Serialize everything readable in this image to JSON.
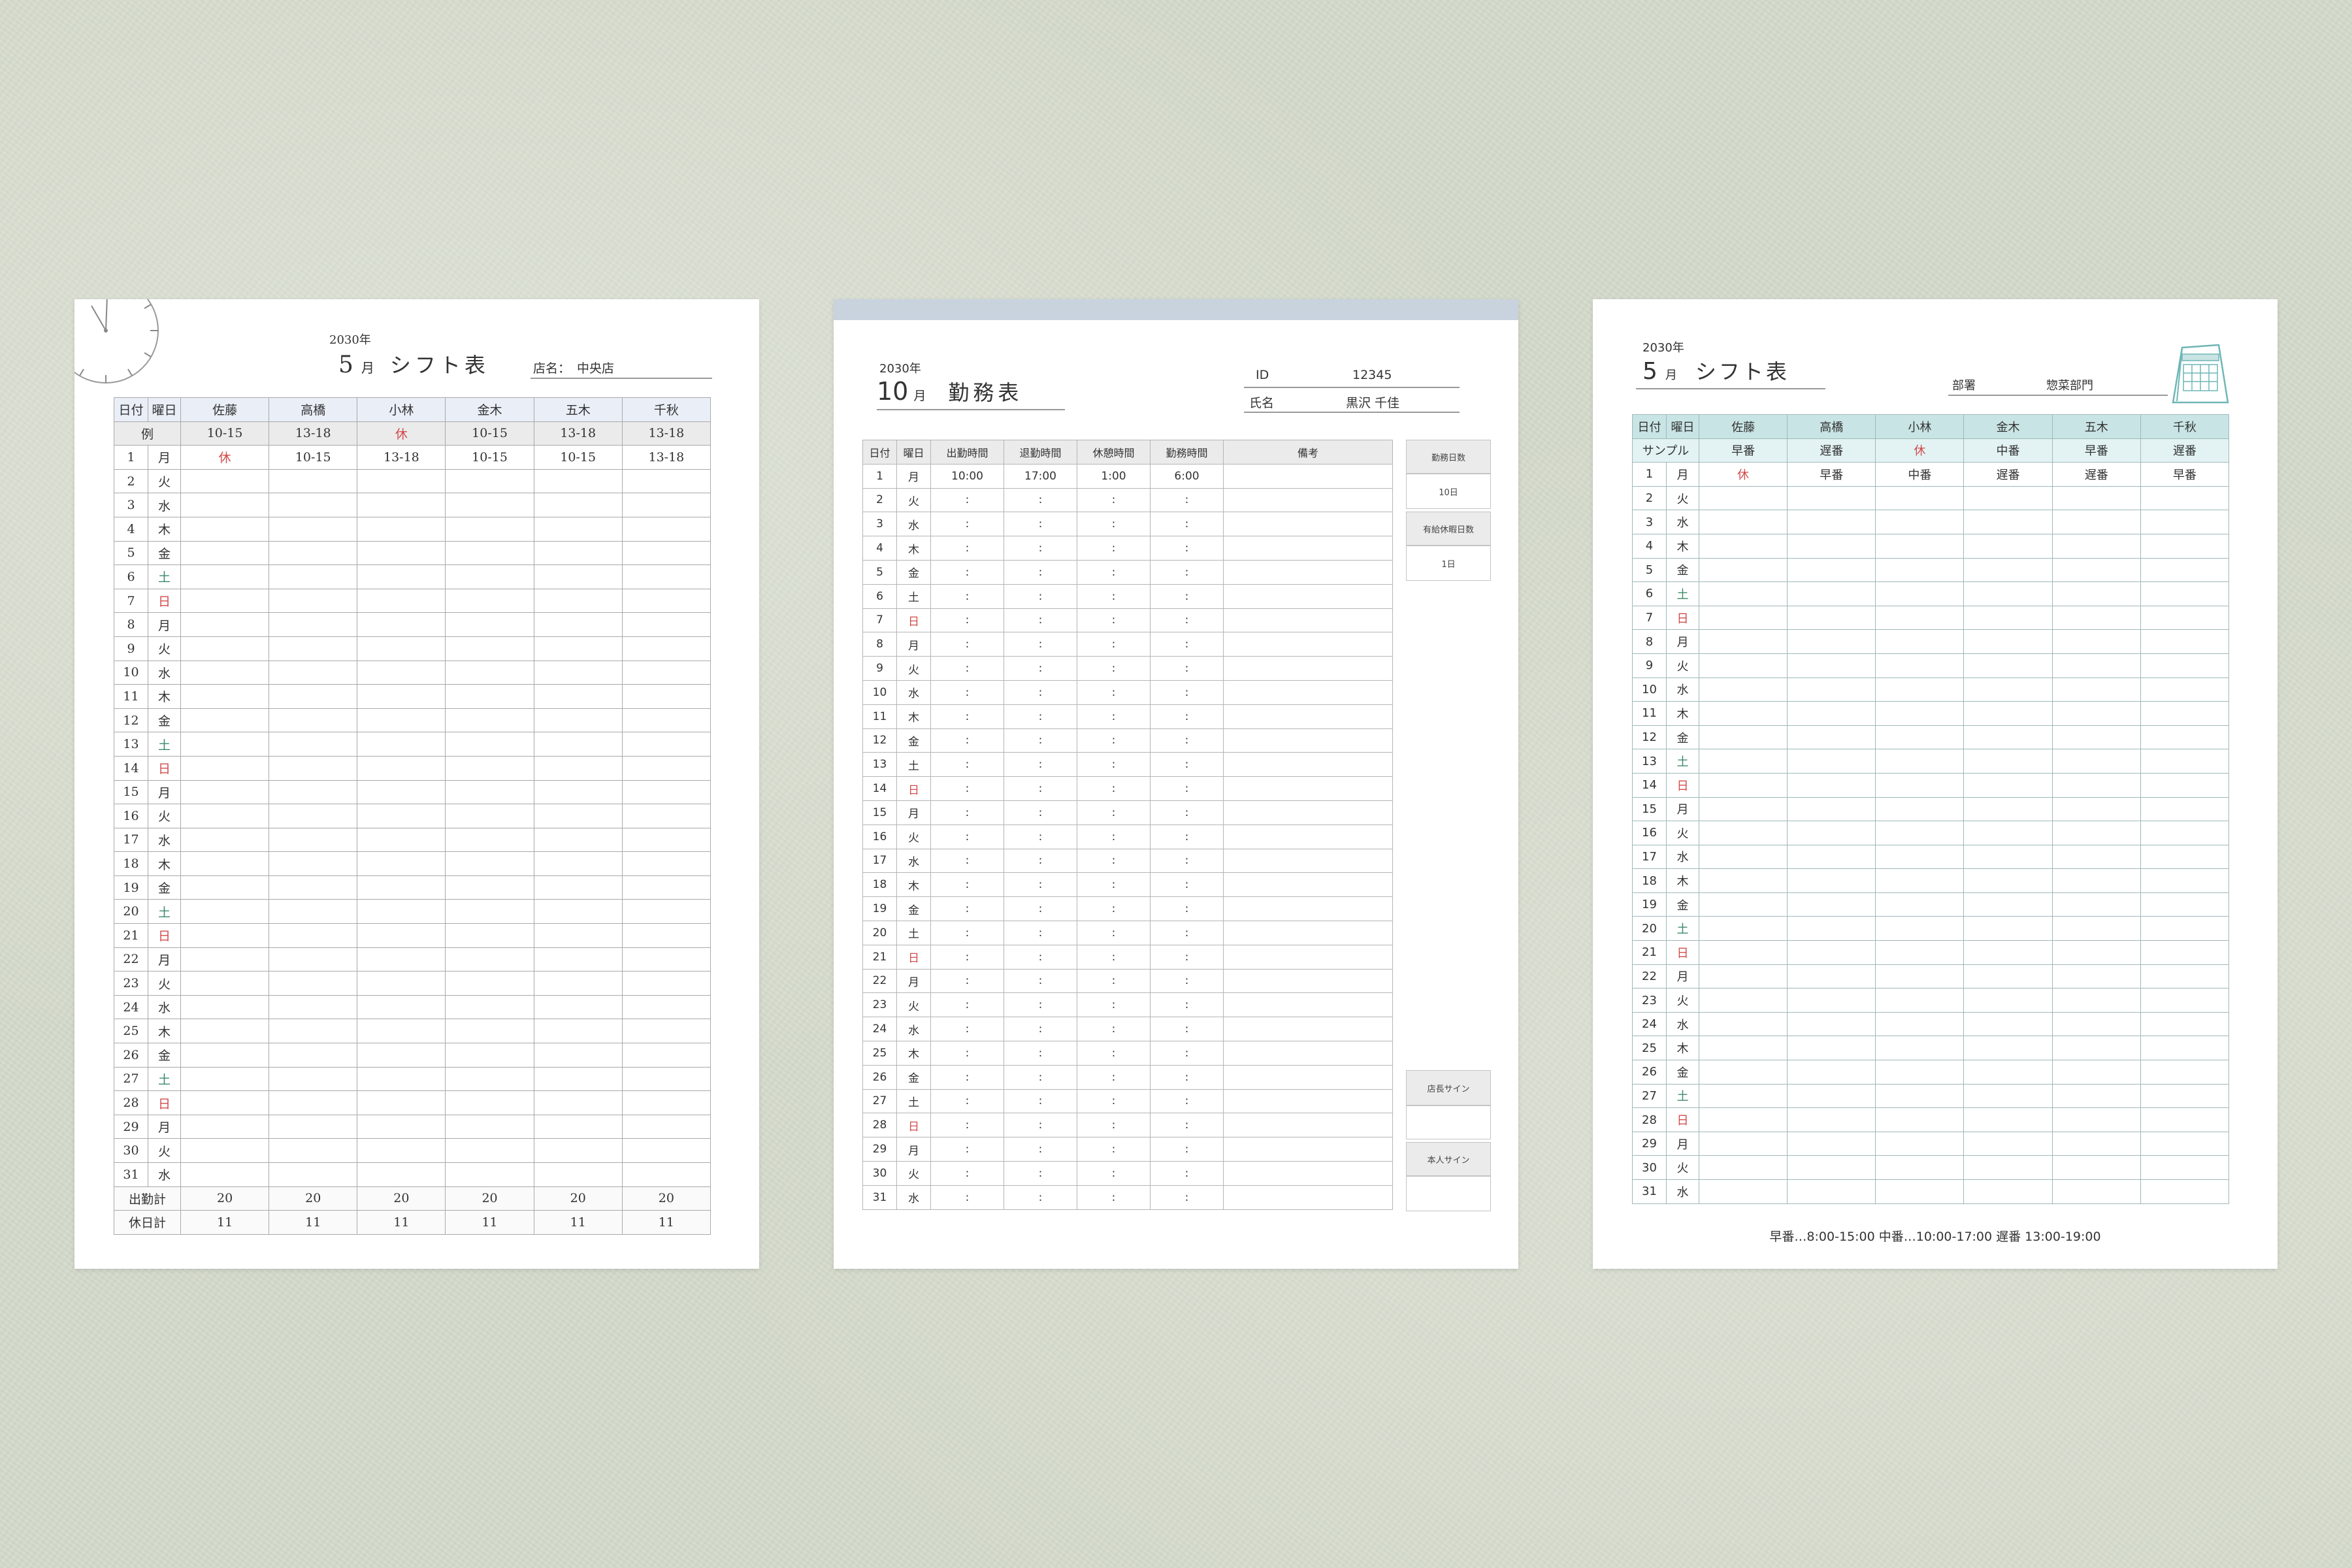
{
  "weekdays": [
    "月",
    "火",
    "水",
    "木",
    "金",
    "土",
    "日"
  ],
  "sheet1": {
    "year": "2030年",
    "month": "5",
    "month_unit": "月",
    "title": "シフト表",
    "store_label": "店名：",
    "store_name": "中央店",
    "headers": [
      "日付",
      "曜日",
      "佐藤",
      "高橋",
      "小林",
      "金木",
      "五木",
      "千秋"
    ],
    "example_label": "例",
    "example_row": [
      "10-15",
      "13-18",
      "休",
      "10-15",
      "13-18",
      "13-18"
    ],
    "first_day_row": [
      "休",
      "10-15",
      "13-18",
      "10-15",
      "10-15",
      "13-18"
    ],
    "start_weekday": 0,
    "days": 31,
    "work_total_label": "出勤計",
    "work_totals": [
      "20",
      "20",
      "20",
      "20",
      "20",
      "20"
    ],
    "off_total_label": "休日計",
    "off_totals": [
      "11",
      "11",
      "11",
      "11",
      "11",
      "11"
    ]
  },
  "sheet2": {
    "year": "2030年",
    "month": "10",
    "month_unit": "月",
    "title": "勤務表",
    "id_label": "ID",
    "id_value": "12345",
    "name_label": "氏名",
    "name_value": "黒沢 千佳",
    "headers": [
      "日付",
      "曜日",
      "出勤時間",
      "退勤時間",
      "休憩時間",
      "勤務時間",
      "備考"
    ],
    "first_row": [
      "10:00",
      "17:00",
      "1:00",
      "6:00"
    ],
    "placeholder": ":",
    "start_weekday": 0,
    "days": 31,
    "work_days_label": "勤務日数",
    "work_days_value": "10日",
    "paid_leave_label": "有給休暇日数",
    "paid_leave_value": "1日",
    "manager_sign_label": "店長サイン",
    "self_sign_label": "本人サイン"
  },
  "sheet3": {
    "year": "2030年",
    "month": "5",
    "month_unit": "月",
    "title": "シフト表",
    "dept_label": "部署",
    "dept_name": "惣菜部門",
    "headers": [
      "日付",
      "曜日",
      "佐藤",
      "高橋",
      "小林",
      "金木",
      "五木",
      "千秋"
    ],
    "example_label": "サンプル",
    "example_row": [
      "早番",
      "遅番",
      "休",
      "中番",
      "早番",
      "遅番"
    ],
    "first_day_row": [
      "休",
      "早番",
      "中番",
      "遅番",
      "遅番",
      "早番"
    ],
    "start_weekday": 0,
    "days": 31,
    "footer_note": "早番…8:00-15:00 中番…10:00-17:00 遅番 13:00-19:00"
  },
  "colors": {
    "sunday": "#d24a4a",
    "saturday": "#3c8a6a",
    "sheet1_header": "#e9eef7",
    "sheet2_band": "#c8d3de",
    "sheet3_header": "#c9e4e4"
  }
}
